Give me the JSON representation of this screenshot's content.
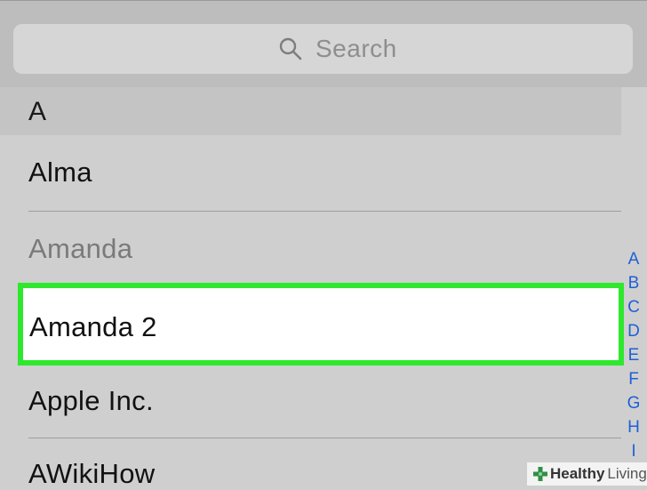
{
  "search": {
    "placeholder": "Search",
    "icon": "search-icon"
  },
  "section": {
    "letter": "A"
  },
  "contacts": [
    {
      "name": "Alma",
      "state": "normal"
    },
    {
      "name": "Amanda",
      "state": "dimmed"
    },
    {
      "name": "Amanda 2",
      "state": "selected"
    },
    {
      "name": "Apple Inc.",
      "state": "normal"
    },
    {
      "name": "AWikiHow",
      "state": "normal"
    }
  ],
  "index": [
    "A",
    "B",
    "C",
    "D",
    "E",
    "F",
    "G",
    "H",
    "I"
  ],
  "colors": {
    "highlight": "#2ee82e",
    "index": "#1f5fd6",
    "dimmed_text": "#7a7a7a",
    "watermark_green": "#2f8f46"
  },
  "watermark": {
    "bold": "Healthy",
    "light": "Living",
    "icon": "plus-leaf-icon"
  }
}
